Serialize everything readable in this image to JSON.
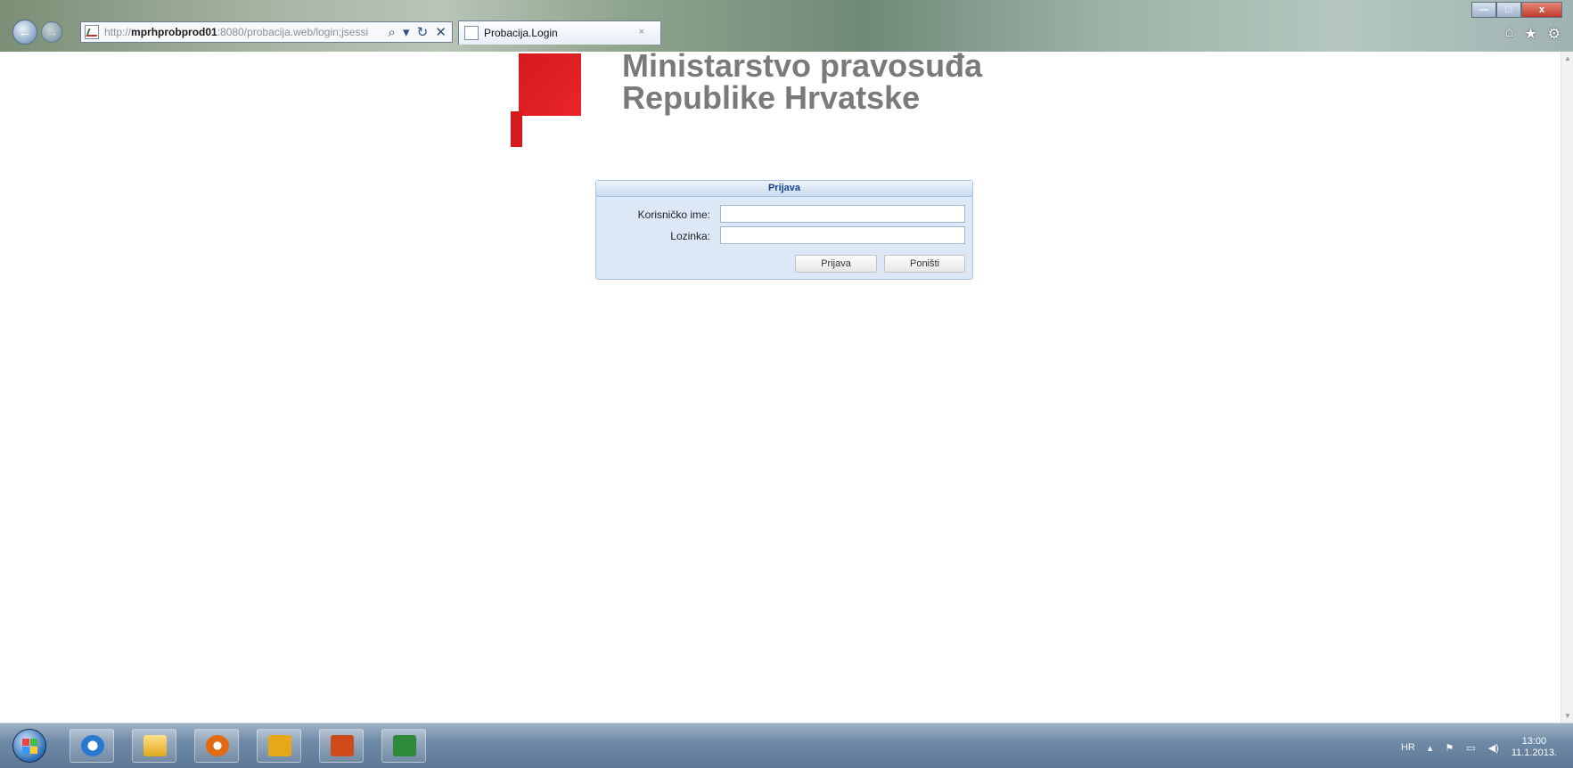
{
  "browser": {
    "address": {
      "prefix": "http://",
      "host": "mprhprobprod01",
      "rest": ":8080/probacija.web/login;jsessi",
      "controls": "⌕ ▾ ↻ ✕"
    },
    "tab": {
      "title": "Probacija.Login",
      "close": "×"
    },
    "window_controls": {
      "minimize": "—",
      "maximize": "□",
      "close": "x"
    },
    "tool_icons": {
      "home": "⌂",
      "favorites": "★",
      "tools": "⚙"
    }
  },
  "logo": {
    "line1": "Ministarstvo pravosuđa",
    "line2": "Republike Hrvatske",
    "color": "#d7191e"
  },
  "login": {
    "title": "Prijava",
    "username_label": "Korisničko ime:",
    "password_label": "Lozinka:",
    "username_value": "",
    "password_value": "",
    "submit_label": "Prijava",
    "cancel_label": "Poništi"
  },
  "taskbar": {
    "apps": [
      "start",
      "internet-explorer",
      "file-explorer",
      "media-player",
      "outlook",
      "powerpoint",
      "excel"
    ],
    "tray": {
      "language": "HR",
      "time": "13:00",
      "date": "11.1.2013."
    }
  }
}
